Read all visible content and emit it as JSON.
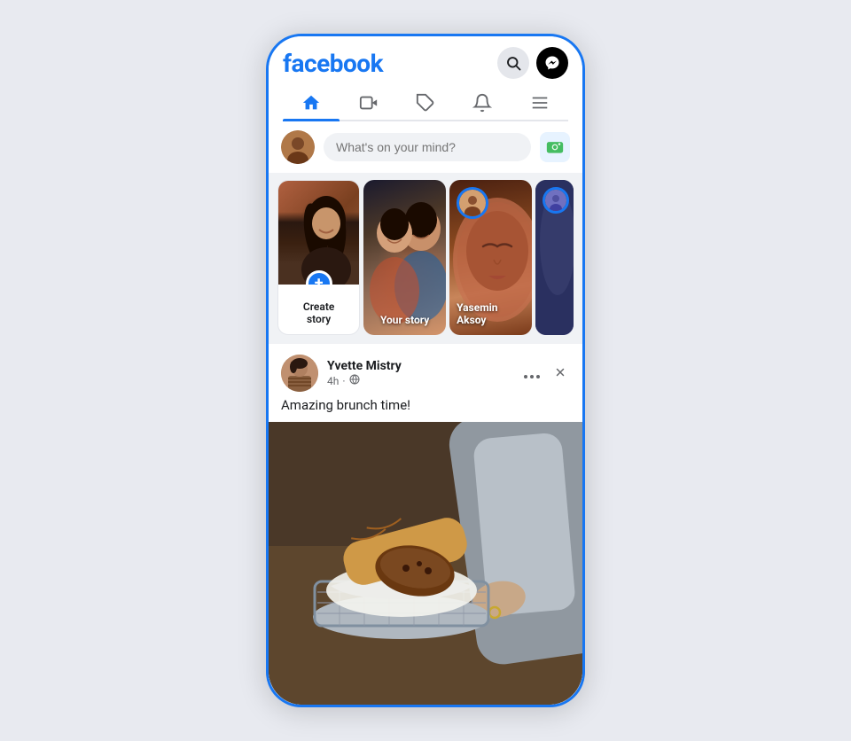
{
  "app": {
    "logo": "facebook"
  },
  "header": {
    "search_icon": "🔍",
    "messenger_icon": "⚡"
  },
  "nav": {
    "items": [
      {
        "id": "home",
        "icon": "🏠",
        "active": true
      },
      {
        "id": "video",
        "icon": "▶"
      },
      {
        "id": "marketplace",
        "icon": "⬡"
      },
      {
        "id": "notifications",
        "icon": "🔔"
      },
      {
        "id": "menu",
        "icon": "≡"
      }
    ]
  },
  "post_box": {
    "placeholder": "What's on your mind?"
  },
  "stories": [
    {
      "id": "create",
      "label": "Create",
      "label2": "story",
      "type": "create"
    },
    {
      "id": "your",
      "label": "Your story",
      "type": "user_own"
    },
    {
      "id": "yasemin",
      "label": "Yasemin",
      "label2": "Aksoy",
      "type": "friend"
    },
    {
      "id": "fourth",
      "label": "",
      "type": "friend_partial"
    }
  ],
  "post": {
    "username": "Yvette Mistry",
    "time": "4h",
    "globe_icon": "🌐",
    "text": "Amazing brunch time!",
    "more_icon": "•••",
    "close_icon": "✕"
  }
}
